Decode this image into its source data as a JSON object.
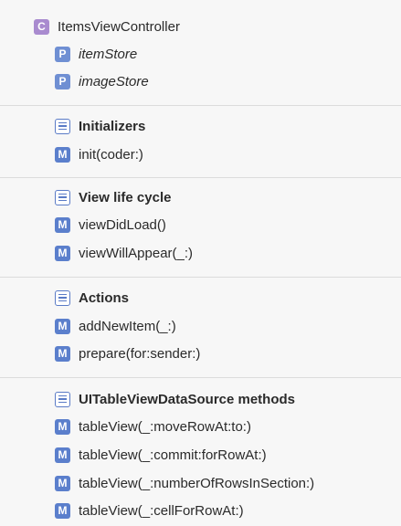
{
  "class": {
    "badge": "C",
    "label": "ItemsViewController"
  },
  "properties": [
    {
      "badge": "P",
      "label": "itemStore"
    },
    {
      "badge": "P",
      "label": "imageStore"
    }
  ],
  "groups": [
    {
      "title": "Initializers",
      "methods": [
        "init(coder:)"
      ]
    },
    {
      "title": "View life cycle",
      "methods": [
        "viewDidLoad()",
        "viewWillAppear(_:)"
      ]
    },
    {
      "title": "Actions",
      "methods": [
        "addNewItem(_:)",
        "prepare(for:sender:)"
      ]
    },
    {
      "title": "UITableViewDataSource methods",
      "methods": [
        "tableView(_:moveRowAt:to:)",
        "tableView(_:commit:forRowAt:)",
        "tableView(_:numberOfRowsInSection:)",
        "tableView(_:cellForRowAt:)"
      ]
    }
  ],
  "method_badge": "M",
  "colors": {
    "class_badge": "#a98bcf",
    "property_badge": "#6f8fd3",
    "method_badge": "#5b7fcc",
    "mark_badge": "#5a7bc6"
  }
}
